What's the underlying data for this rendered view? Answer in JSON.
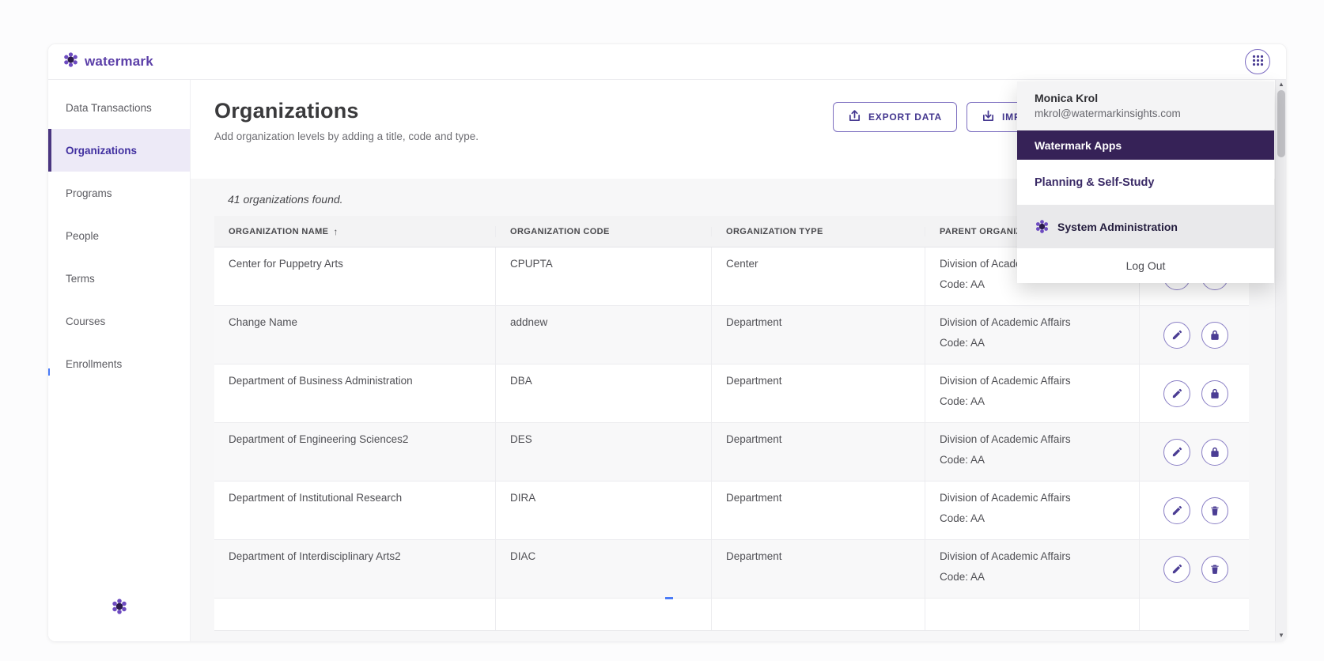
{
  "brand": {
    "name": "watermark"
  },
  "sidebar": {
    "items": [
      {
        "label": "Data Transactions",
        "active": false
      },
      {
        "label": "Organizations",
        "active": true
      },
      {
        "label": "Programs",
        "active": false
      },
      {
        "label": "People",
        "active": false
      },
      {
        "label": "Terms",
        "active": false
      },
      {
        "label": "Courses",
        "active": false
      },
      {
        "label": "Enrollments",
        "active": false
      }
    ]
  },
  "page": {
    "title": "Organizations",
    "subtitle": "Add organization levels by adding a title, code and type.",
    "export_button": "EXPORT DATA",
    "import_button": "IMPORT DATA",
    "results_summary": "41 organizations found."
  },
  "table": {
    "headers": {
      "name": "ORGANIZATION NAME",
      "code": "ORGANIZATION CODE",
      "type": "ORGANIZATION TYPE",
      "parent": "PARENT ORGANIZATION"
    },
    "sort_arrow": "↑",
    "rows": [
      {
        "name": "Center for Puppetry Arts",
        "code": "CPUPTA",
        "type": "Center",
        "parent_name": "Division of Academic Affairs",
        "parent_code": "Code: AA",
        "actions": [
          "edit",
          "lock"
        ]
      },
      {
        "name": "Change Name",
        "code": "addnew",
        "type": "Department",
        "parent_name": "Division of Academic Affairs",
        "parent_code": "Code: AA",
        "actions": [
          "edit",
          "lock"
        ]
      },
      {
        "name": "Department of Business Administration",
        "code": "DBA",
        "type": "Department",
        "parent_name": "Division of Academic Affairs",
        "parent_code": "Code: AA",
        "actions": [
          "edit",
          "lock"
        ]
      },
      {
        "name": "Department of Engineering Sciences2",
        "code": "DES",
        "type": "Department",
        "parent_name": "Division of Academic Affairs",
        "parent_code": "Code: AA",
        "actions": [
          "edit",
          "lock"
        ]
      },
      {
        "name": "Department of Institutional Research",
        "code": "DIRA",
        "type": "Department",
        "parent_name": "Division of Academic Affairs",
        "parent_code": "Code: AA",
        "actions": [
          "edit",
          "delete"
        ]
      },
      {
        "name": "Department of Interdisciplinary Arts2",
        "code": "DIAC",
        "type": "Department",
        "parent_name": "Division of Academic Affairs",
        "parent_code": "Code: AA",
        "actions": [
          "edit",
          "delete"
        ]
      }
    ]
  },
  "user_menu": {
    "name": "Monica Krol",
    "email": "mkrol@watermarkinsights.com",
    "section_header": "Watermark Apps",
    "apps": [
      {
        "label": "Planning & Self-Study"
      },
      {
        "label": "System Administration"
      }
    ],
    "logout": "Log Out"
  },
  "colors": {
    "brand_purple": "#5b3fa8",
    "accent_purple": "#43368f",
    "dark_purple_band": "#362257",
    "active_item_bg": "#edeaf7",
    "content_bg": "#f7f7f8"
  }
}
